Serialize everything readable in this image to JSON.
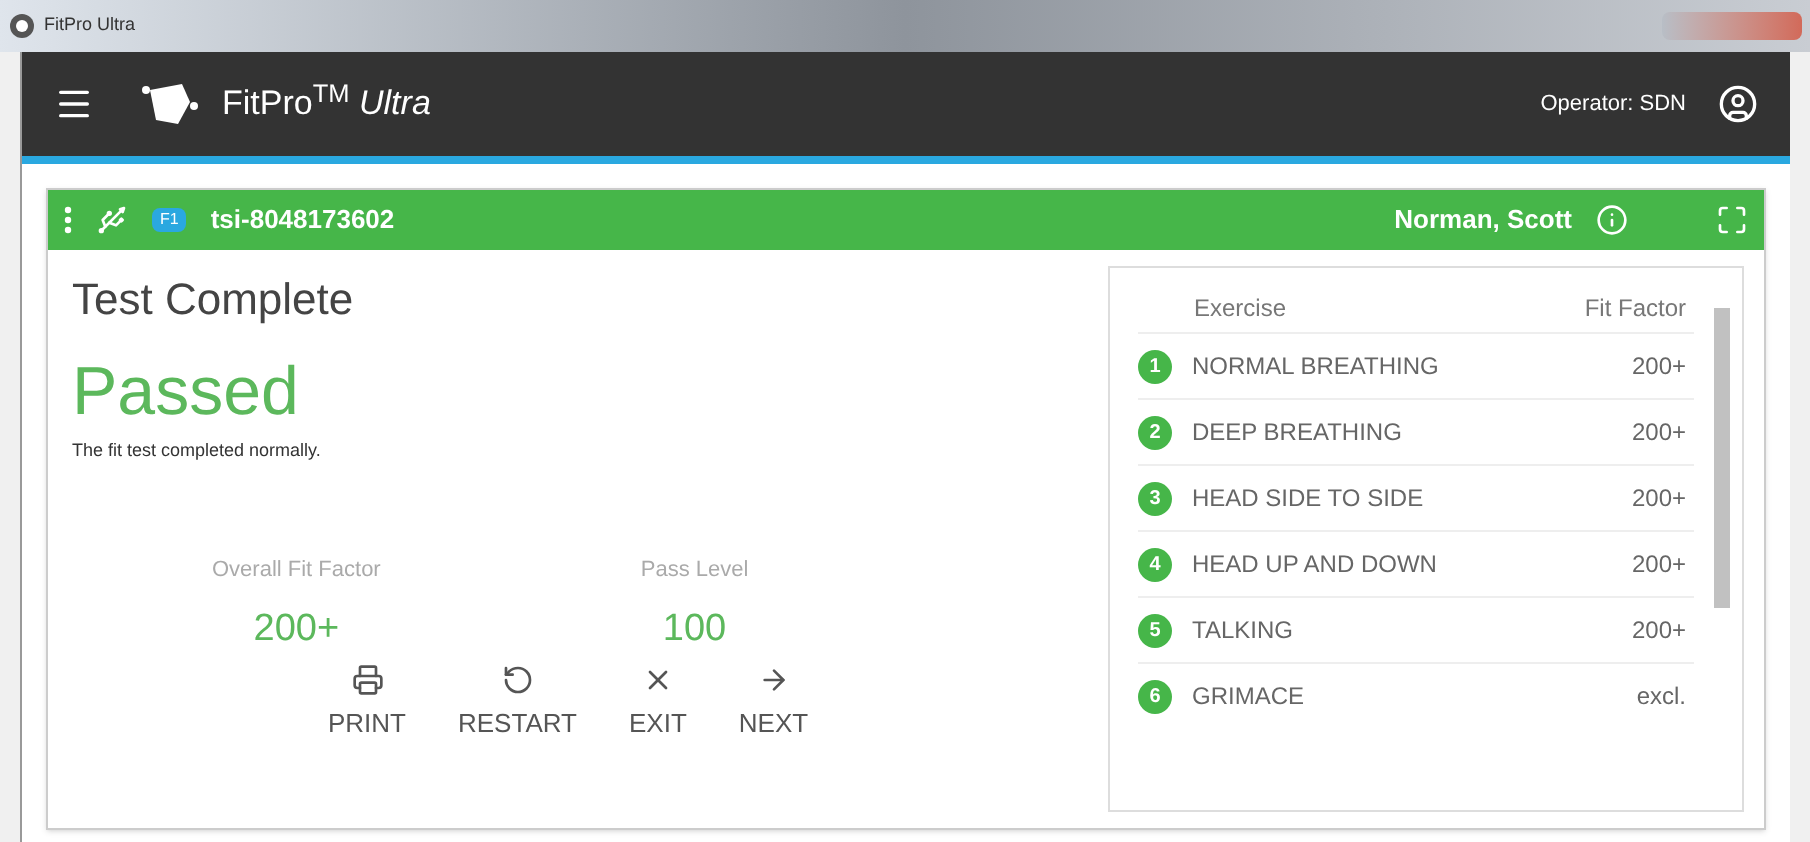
{
  "window": {
    "title": "FitPro Ultra"
  },
  "app_bar": {
    "brand": "FitPro$^{TM}$ *Ultra*",
    "operator": "Operator: SDN"
  },
  "device_bar": {
    "badge": "F1",
    "device_id": "tsi-8048173602",
    "subject": "Norman, Scott"
  },
  "result": {
    "heading": "Test Complete",
    "status": "Passed",
    "message": "The fit test completed normally.",
    "overall_label": "Overall Fit Factor",
    "overall_value": "200+",
    "pass_label": "Pass Level",
    "pass_value": "100"
  },
  "actions": [
    {
      "label": "PRINT",
      "kind": "print"
    },
    {
      "label": "RESTART",
      "kind": "restart"
    },
    {
      "label": "EXIT",
      "kind": "exit"
    },
    {
      "label": "NEXT",
      "kind": "next"
    }
  ],
  "table": {
    "columns": [
      "Exercise",
      "Fit Factor"
    ],
    "rows": [
      {
        "number": "1",
        "exercise": "NORMAL BREATHING",
        "fit_factor": "200+"
      },
      {
        "number": "2",
        "exercise": "DEEP BREATHING",
        "fit_factor": "200+"
      },
      {
        "number": "3",
        "exercise": "HEAD SIDE TO SIDE",
        "fit_factor": "200+"
      },
      {
        "number": "4",
        "exercise": "HEAD UP AND DOWN",
        "fit_factor": "200+"
      },
      {
        "number": "5",
        "exercise": "TALKING",
        "fit_factor": "200+"
      },
      {
        "number": "6",
        "exercise": "GRIMACE",
        "fit_factor": "excl."
      }
    ]
  }
}
